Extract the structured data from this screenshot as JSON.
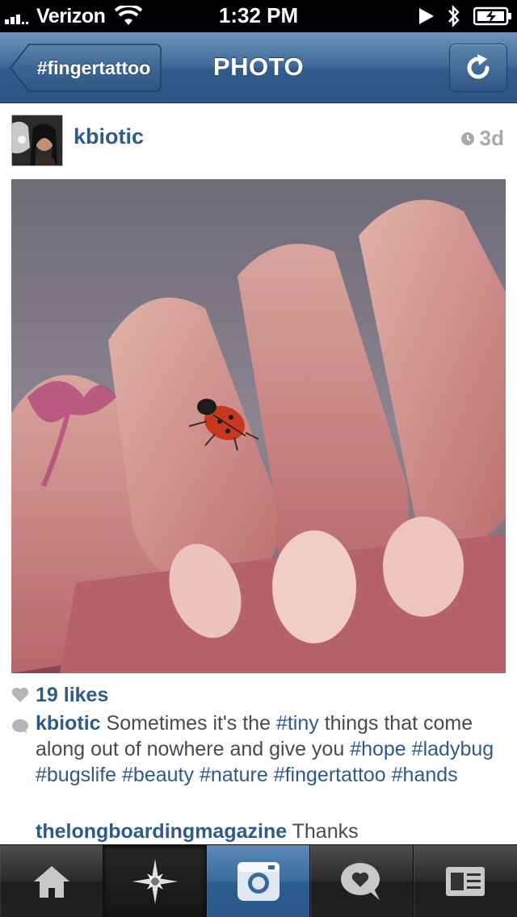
{
  "status_bar": {
    "carrier": "Verizon",
    "time": "1:32 PM"
  },
  "nav": {
    "back_label": "#fingertattoo",
    "title": "PHOTO",
    "refresh_icon": "refresh-icon"
  },
  "post": {
    "username": "kbiotic",
    "time_ago": "3d",
    "likes": "19 likes",
    "caption": {
      "user": "kbiotic",
      "text_1": " Sometimes it's the ",
      "tag_tiny": "#tiny",
      "text_2": " things that come along out of nowhere and give you ",
      "tag_hope": "#hope",
      "tag_ladybug": "#ladybug",
      "tag_bugslife": "#bugslife",
      "tag_beauty": "#beauty",
      "tag_nature": "#nature",
      "tag_fingertattoo": "#fingertattoo",
      "tag_hands": "#hands"
    },
    "comment": {
      "user": "thelongboardingmagazine",
      "text": " Thanks"
    }
  },
  "tab_bar": {
    "tabs": [
      {
        "icon": "home-icon"
      },
      {
        "icon": "explore-star-icon"
      },
      {
        "icon": "camera-icon"
      },
      {
        "icon": "news-heart-icon"
      },
      {
        "icon": "profile-card-icon"
      }
    ],
    "active_index": 2
  },
  "colors": {
    "link_blue": "#2e5b88",
    "nav_blue": "#40699a",
    "text_gray": "#4a4a4a"
  }
}
